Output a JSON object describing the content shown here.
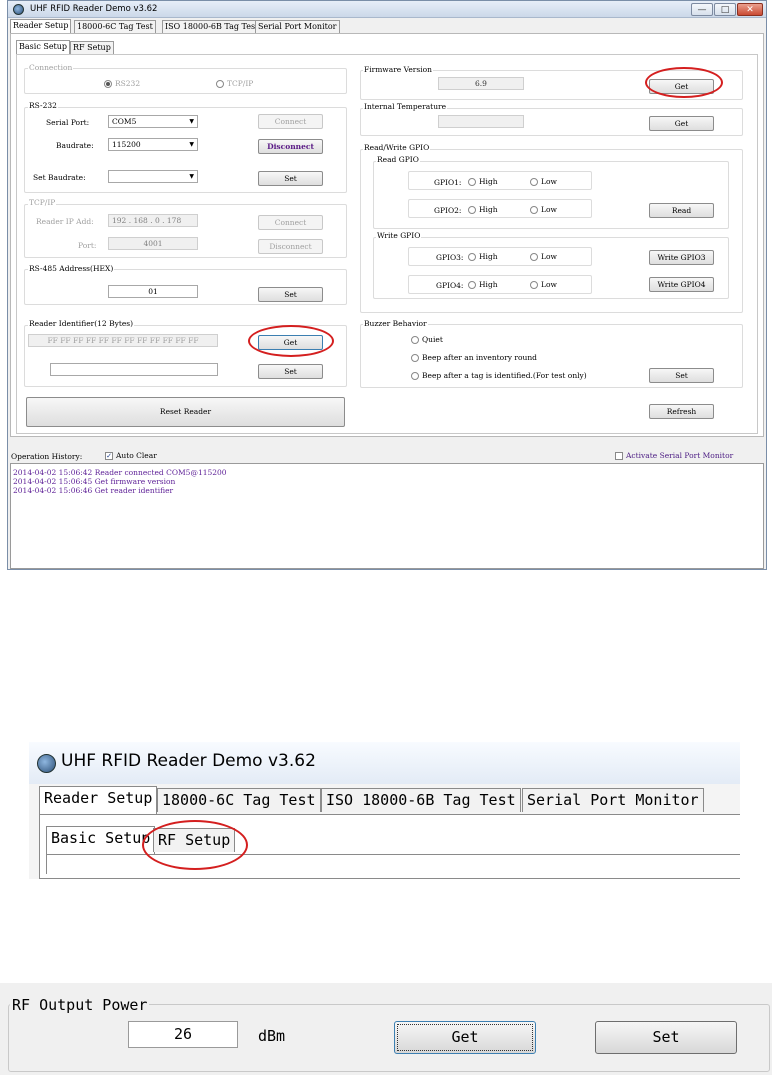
{
  "window": {
    "title": "UHF RFID Reader Demo v3.62",
    "controls": {
      "minimize": "—",
      "maximize": "□",
      "close": "✕"
    }
  },
  "main_tabs": [
    "Reader Setup",
    "18000-6C Tag Test",
    "ISO 18000-6B Tag Test",
    "Serial Port Monitor"
  ],
  "sub_tabs": [
    "Basic Setup",
    "RF Setup"
  ],
  "connection": {
    "label": "Connection",
    "rs232": "RS232",
    "tcpip": "TCP/IP"
  },
  "rs232": {
    "label": "RS-232",
    "serial_port_label": "Serial Port:",
    "serial_port_value": "COM5",
    "baudrate_label": "Baudrate:",
    "baudrate_value": "115200",
    "set_baudrate_label": "Set Baudrate:",
    "set_baudrate_value": "",
    "connect": "Connect",
    "disconnect": "Disconnect",
    "set": "Set"
  },
  "tcp": {
    "label": "TCP/IP",
    "ip_label": "Reader IP Add:",
    "ip": [
      "192",
      "168",
      "0",
      "178"
    ],
    "port_label": "Port:",
    "port_value": "4001",
    "connect": "Connect",
    "disconnect": "Disconnect"
  },
  "rs485": {
    "label": "RS-485 Address(HEX)",
    "value": "01",
    "set": "Set"
  },
  "identifier": {
    "label": "Reader Identifier(12 Bytes)",
    "value": "FF FF FF FF FF FF FF FF FF FF FF FF",
    "get": "Get",
    "new_value": "",
    "set": "Set"
  },
  "reset": "Reset Reader",
  "firmware": {
    "label": "Firmware Version",
    "value": "6.9",
    "get": "Get"
  },
  "temperature": {
    "label": "Internal Temperature",
    "value": "",
    "get": "Get"
  },
  "gpio": {
    "label": "Read/Write GPIO",
    "read_label": "Read GPIO",
    "write_label": "Write GPIO",
    "high": "High",
    "low": "Low",
    "gpio1": "GPIO1:",
    "gpio2": "GPIO2:",
    "gpio3": "GPIO3:",
    "gpio4": "GPIO4:",
    "read": "Read",
    "write3": "Write GPIO3",
    "write4": "Write GPIO4"
  },
  "buzzer": {
    "label": "Buzzer Behavior",
    "opt1": "Quiet",
    "opt2": "Beep after an inventory round",
    "opt3": "Beep after a tag is identified.(For test only)",
    "set": "Set"
  },
  "refresh": "Refresh",
  "history": {
    "label": "Operation History:",
    "auto_clear": "Auto Clear",
    "activate_monitor": "Activate Serial Port Monitor",
    "entries": [
      "2014-04-02 15:06:42 Reader connected COM5@115200",
      "2014-04-02 15:06:45 Get firmware version",
      "2014-04-02 15:06:46 Get reader identifier"
    ]
  },
  "zoom_tabs": {
    "title": "UHF RFID Reader Demo v3.62",
    "main_tabs": [
      "Reader Setup",
      "18000-6C Tag Test",
      "ISO 18000-6B Tag Test",
      "Serial Port Monitor"
    ],
    "sub_tabs": [
      "Basic Setup",
      "RF Setup"
    ]
  },
  "rf_power": {
    "label": "RF Output Power",
    "value": "26",
    "unit": "dBm",
    "get": "Get",
    "set": "Set"
  },
  "highlight_color": "#d41f1f"
}
